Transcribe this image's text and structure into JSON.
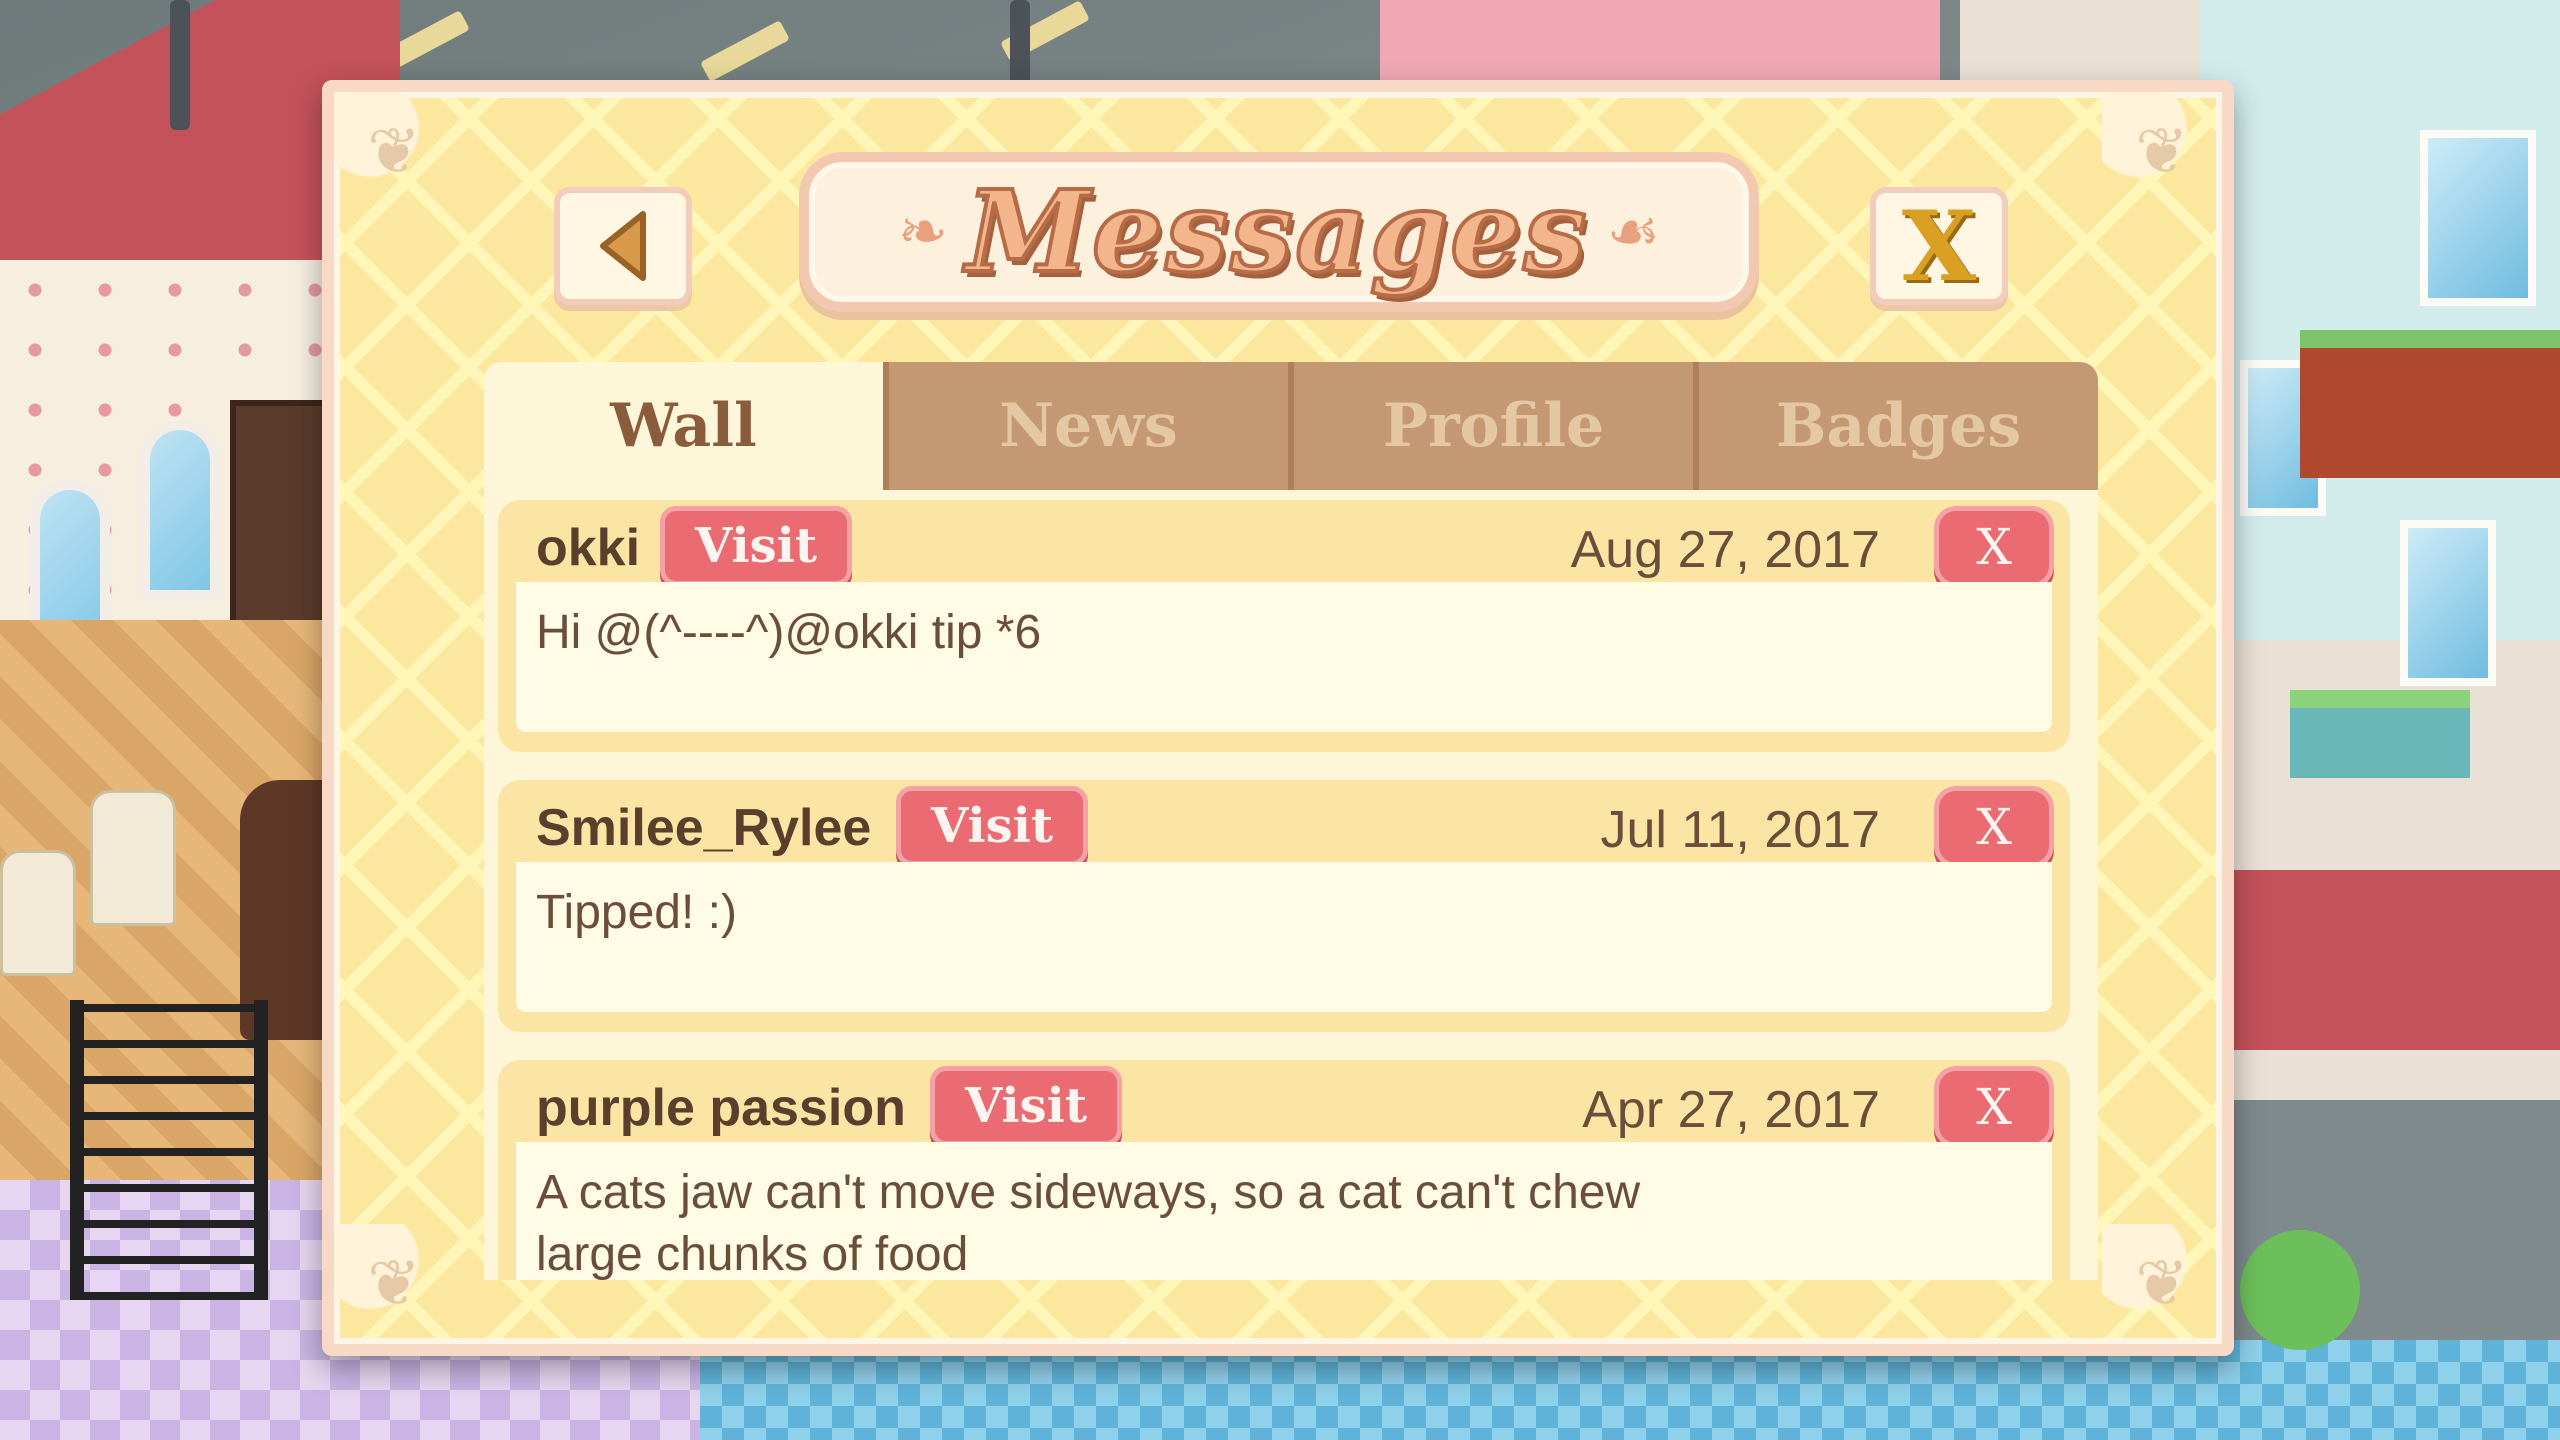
{
  "dialog": {
    "title": "Messages",
    "back_icon": "back-arrow-icon",
    "close_label": "X"
  },
  "tabs": [
    {
      "label": "Wall",
      "active": true
    },
    {
      "label": "News",
      "active": false
    },
    {
      "label": "Profile",
      "active": false
    },
    {
      "label": "Badges",
      "active": false
    }
  ],
  "messages": [
    {
      "name": "okki",
      "visit_label": "Visit",
      "date": "Aug 27, 2017",
      "delete_label": "X",
      "text": "Hi @(^----^)@okki tip *6"
    },
    {
      "name": "Smilee_Rylee",
      "visit_label": "Visit",
      "date": "Jul 11, 2017",
      "delete_label": "X",
      "text": "Tipped! :)"
    },
    {
      "name": "purple passion",
      "visit_label": "Visit",
      "date": "Apr 27, 2017",
      "delete_label": "X",
      "text": "A cats jaw can't move sideways, so a cat can't chew large chunks of food"
    }
  ],
  "colors": {
    "panel": "#fbe89e",
    "tab_inactive": "#c59874",
    "tab_active": "#fdf6d8",
    "button_red": "#ea6b72",
    "title_orange": "#f3b58c"
  }
}
